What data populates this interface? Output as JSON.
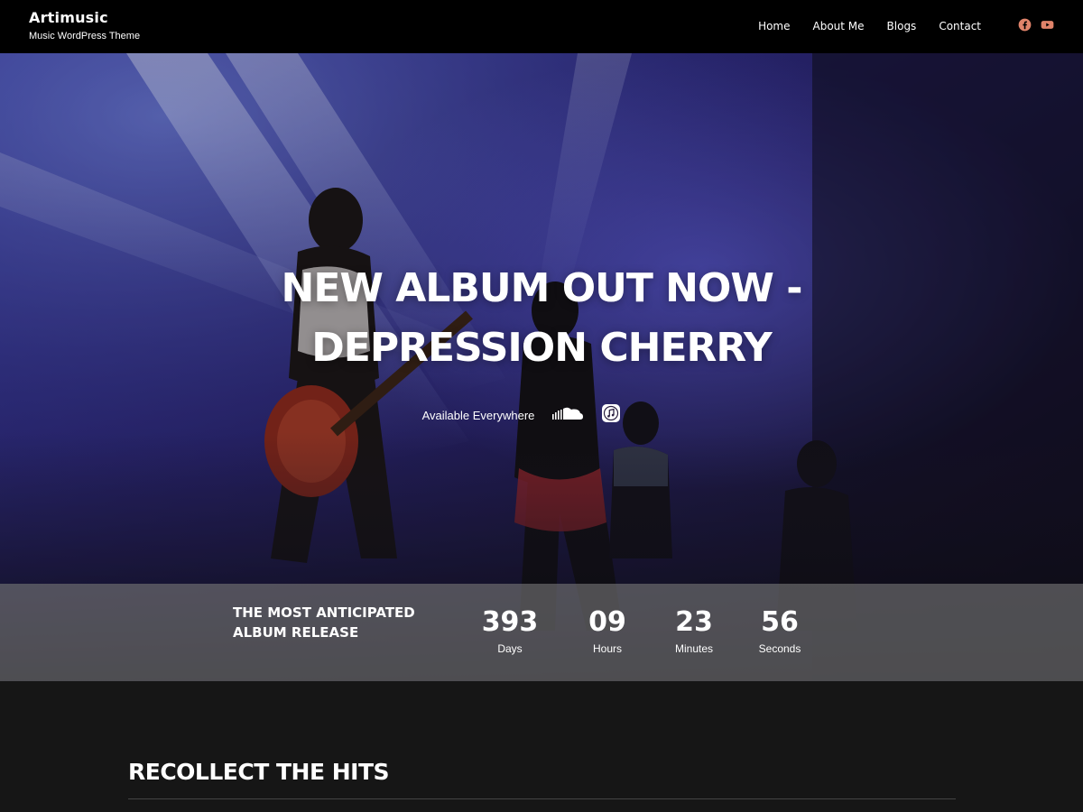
{
  "header": {
    "site_title": "Artimusic",
    "tagline": "Music WordPress Theme",
    "nav": [
      {
        "label": "Home"
      },
      {
        "label": "About Me"
      },
      {
        "label": "Blogs"
      },
      {
        "label": "Contact"
      }
    ],
    "social_icons": [
      "facebook-icon",
      "youtube-icon"
    ],
    "social_icon_color": "#e0836a"
  },
  "hero": {
    "title_line1": "NEW ALBUM OUT NOW -",
    "title_line2": "DEPRESSION CHERRY",
    "available_label": "Available Everywhere",
    "service_icons": [
      "soundcloud-icon",
      "itunes-icon"
    ]
  },
  "countdown": {
    "heading": "THE MOST ANTICIPATED ALBUM RELEASE",
    "units": [
      {
        "value": "393",
        "label": "Days"
      },
      {
        "value": "09",
        "label": "Hours"
      },
      {
        "value": "23",
        "label": "Minutes"
      },
      {
        "value": "56",
        "label": "Seconds"
      }
    ]
  },
  "hits": {
    "title": "RECOLLECT THE HITS"
  },
  "colors": {
    "header_bg": "#000000",
    "hits_bg": "#161616",
    "accent": "#e0836a"
  }
}
